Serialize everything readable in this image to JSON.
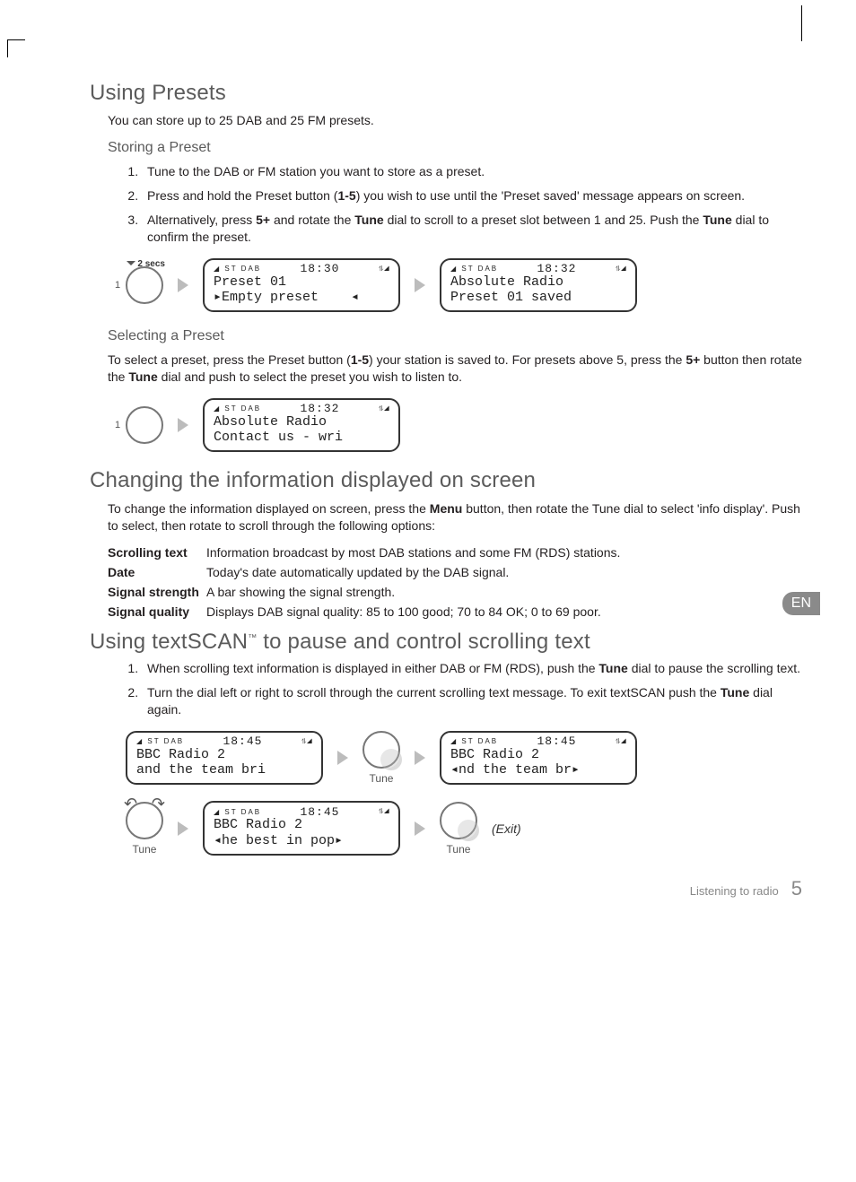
{
  "lang_tab": "EN",
  "footer": {
    "section": "Listening to radio",
    "page": "5"
  },
  "sec1": {
    "title": "Using Presets",
    "intro": "You can store up to 25 DAB and 25 FM presets.",
    "h_store": "Storing a Preset",
    "steps_store": [
      "Tune to the DAB or FM station you want to store as a preset.",
      "Press and hold the Preset button (1-5) you wish to use until the 'Preset saved' message appears on screen.",
      "Alternatively, press 5+ and rotate the Tune dial to scroll to a preset slot between 1 and 25. Push the Tune dial to confirm the preset."
    ],
    "diag_store": {
      "dial_num": "1",
      "hold_label": "2 secs",
      "lcd1": {
        "clock": "18:30",
        "l1": "Preset 01",
        "l2": "▸Empty preset    ◂"
      },
      "lcd2": {
        "clock": "18:32",
        "l1": "Absolute Radio",
        "l2": "Preset 01 saved"
      }
    },
    "h_select": "Selecting a Preset",
    "p_select": "To select a preset, press the Preset button (1-5) your station is saved to. For presets above 5, press the 5+ button then rotate the Tune dial and push to select the preset you wish to listen to.",
    "diag_select": {
      "dial_num": "1",
      "lcd": {
        "clock": "18:32",
        "l1": "Absolute Radio",
        "l2": "Contact us - wri"
      }
    }
  },
  "sec2": {
    "title": "Changing the information displayed on screen",
    "p": "To change the information displayed on screen, press the Menu button, then rotate the Tune dial to select 'info display'. Push to select, then rotate to scroll through the following options:",
    "rows": [
      {
        "k": "Scrolling text",
        "v": "Information broadcast by most DAB stations and some FM (RDS) stations."
      },
      {
        "k": "Date",
        "v": "Today's date automatically updated by the DAB signal."
      },
      {
        "k": "Signal strength",
        "v": "A bar showing the signal strength."
      },
      {
        "k": "Signal quality",
        "v": "Displays DAB signal quality: 85 to 100 good; 70 to 84 OK; 0 to 69 poor."
      }
    ]
  },
  "sec3": {
    "title_a": "Using textSCAN",
    "title_tm": "™",
    "title_b": " to pause and control scrolling text",
    "steps": [
      "When scrolling text information is displayed in either DAB or FM (RDS), push the Tune dial to pause the scrolling text.",
      "Turn the dial left or right to scroll through the current scrolling text message. To exit textSCAN push the Tune dial again."
    ],
    "row1": {
      "lcd1": {
        "clock": "18:45",
        "l1": "BBC Radio 2",
        "l2": "and the team bri"
      },
      "dial_label": "Tune",
      "lcd2": {
        "clock": "18:45",
        "l1": "BBC Radio 2",
        "l2": "◂nd the team br▸"
      }
    },
    "row2": {
      "dial_label_left": "Tune",
      "lcd": {
        "clock": "18:45",
        "l1": "BBC Radio 2",
        "l2": "◂he best in pop▸"
      },
      "dial_label_right": "Tune",
      "exit": "(Exit)"
    }
  },
  "lcd_icons": {
    "left": "◢ ST  DAB",
    "right": "⥮◢"
  }
}
